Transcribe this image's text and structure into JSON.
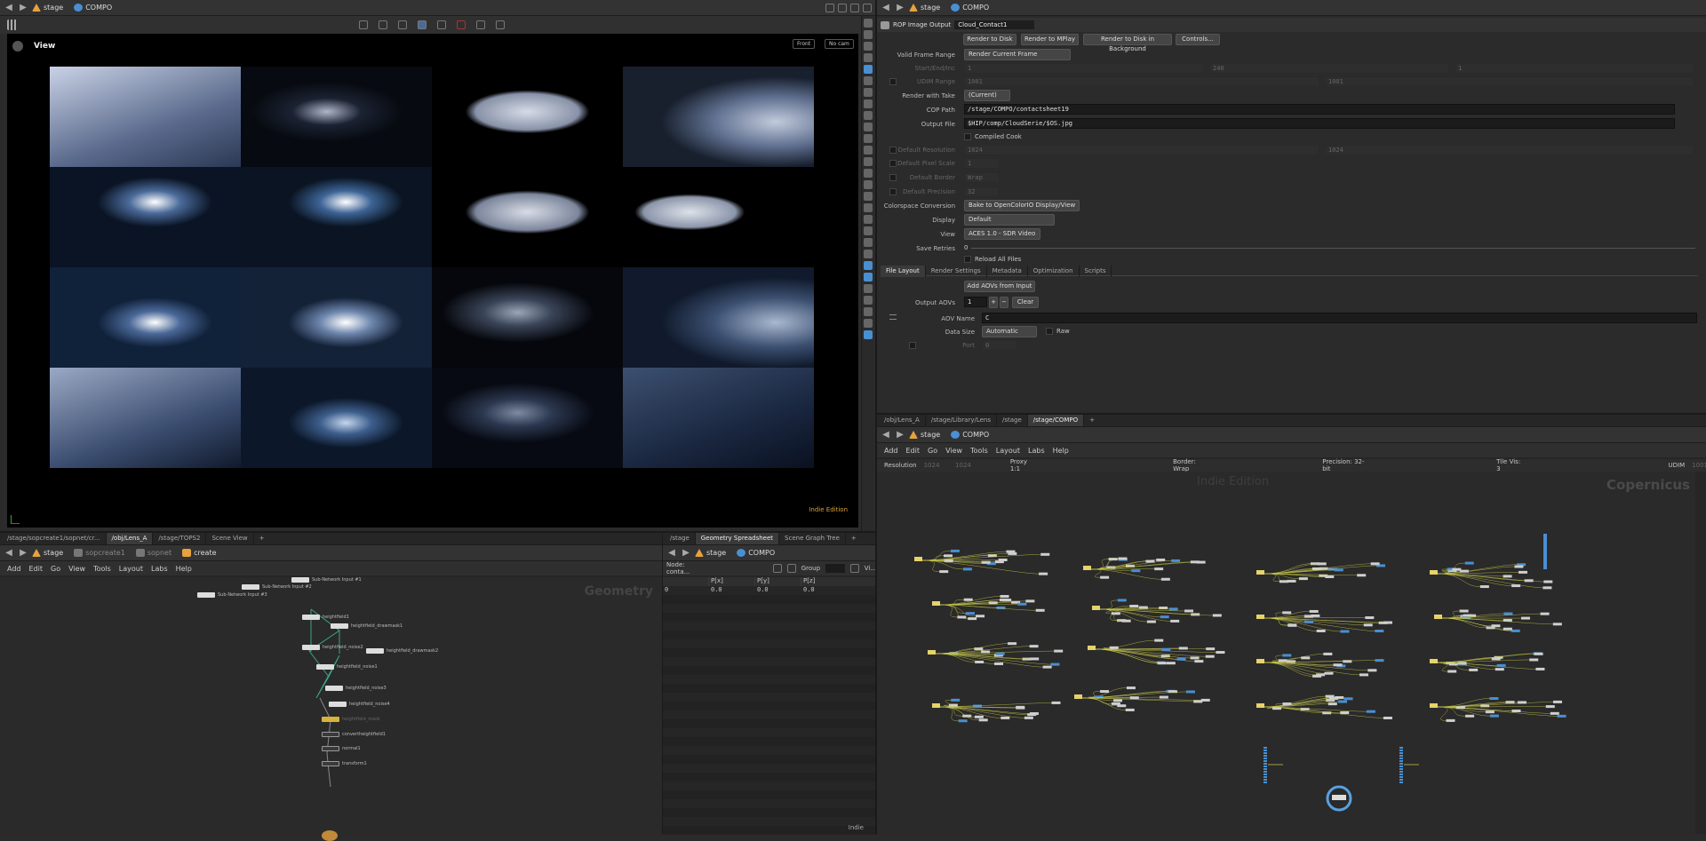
{
  "left_pathbar": {
    "items": [
      "stage",
      "COMPO"
    ]
  },
  "viewer": {
    "title": "View",
    "cam_front": "Front",
    "cam_no": "No cam",
    "edition": "Indie Edition"
  },
  "clouds": [
    {
      "a": "#c9d2e6",
      "b": "#5a6a8c",
      "c": "#2c3854",
      "kind": "haze"
    },
    {
      "a": "#aeb6c8",
      "b": "#1b2232",
      "c": "#070a10",
      "kind": "dark"
    },
    {
      "a": "#d6dbe6",
      "b": "#8892a8",
      "c": "#000",
      "kind": "puff"
    },
    {
      "a": "#c2cbdc",
      "b": "#5f6f8f",
      "c": "#18202e",
      "kind": "puffedge"
    },
    {
      "a": "#ffffff",
      "b": "#4a6a9a",
      "c": "#0a1424",
      "kind": "glow"
    },
    {
      "a": "#ffffff",
      "b": "#3d6496",
      "c": "#0a1422",
      "kind": "glow2"
    },
    {
      "a": "#d8dce6",
      "b": "#7c869c",
      "c": "#000",
      "kind": "puff"
    },
    {
      "a": "#dde2ea",
      "b": "#8c96aa",
      "c": "#000",
      "kind": "puffhalf"
    },
    {
      "a": "#ffffff",
      "b": "#4a6898",
      "c": "#10213a",
      "kind": "glow"
    },
    {
      "a": "#ffffff",
      "b": "#6d86ad",
      "c": "#142238",
      "kind": "glow"
    },
    {
      "a": "#9ca6b8",
      "b": "#3a4458",
      "c": "#05070c",
      "kind": "dark"
    },
    {
      "a": "#a8b8d0",
      "b": "#3b4f70",
      "c": "#101a2c",
      "kind": "puffedge"
    },
    {
      "a": "#9aa9c4",
      "b": "#3b4d70",
      "c": "#101a2c",
      "kind": "haze"
    },
    {
      "a": "#c5d6ec",
      "b": "#3d5e8c",
      "c": "#0c182a",
      "kind": "glow"
    },
    {
      "a": "#7c8aa2",
      "b": "#2c3850",
      "c": "#070a12",
      "kind": "dark"
    },
    {
      "a": "#3c5070",
      "b": "#1a2740",
      "c": "#0a1120",
      "kind": "haze"
    }
  ],
  "bottom_left": {
    "tabs": [
      "/stage/sopcreate1/sopnet/cr...",
      "/obj/Lens_A",
      "/stage/TOPS2",
      "Scene View"
    ],
    "crumbs": [
      "stage",
      "sopcreate1",
      "sopnet",
      "create"
    ],
    "menu": [
      "Add",
      "Edit",
      "Go",
      "View",
      "Tools",
      "Layout",
      "Labs",
      "Help"
    ],
    "watermark": "Geometry",
    "nodes": [
      {
        "label": "Sub-Network Input #1"
      },
      {
        "label": "Sub-Network Input #2"
      },
      {
        "label": "Sub-Network Input #3"
      },
      {
        "label": "heightfield1"
      },
      {
        "label": "heightfield_drawmask1"
      },
      {
        "label": "heightfield_noise2"
      },
      {
        "label": "heightfield_drawmask2"
      },
      {
        "label": "heightfield_noise1"
      },
      {
        "label": "heightfield_noise3"
      },
      {
        "label": "heightfield_noise4"
      },
      {
        "label": "heightfield_mask"
      },
      {
        "label": "convertheightfield1"
      },
      {
        "label": "normal1"
      },
      {
        "label": "transform1"
      }
    ]
  },
  "spreadsheet": {
    "tabs": [
      "/stage",
      "Geometry Spreadsheet",
      "Scene Graph Tree"
    ],
    "crumbs": [
      "stage",
      "COMPO"
    ],
    "node_label": "Node: conta...",
    "group_label": "Group",
    "view_label": "Vi...",
    "columns": [
      "",
      "P[x]",
      "P[y]",
      "P[z]"
    ],
    "row": [
      "0",
      "0.0",
      "0.0",
      "0.0"
    ],
    "footer": "Indie"
  },
  "rop": {
    "header_label": "ROP Image Output",
    "name": "Cloud_Contact1",
    "buttons": [
      "Render to Disk",
      "Render to MPlay",
      "Render to Disk in Background",
      "Controls..."
    ],
    "valid_frame_range_label": "Valid Frame Range",
    "valid_frame_range": "Render Current Frame",
    "start_end_inc_label": "Start/End/Inc",
    "start": "1",
    "end": "240",
    "inc": "1",
    "udim_range_label": "UDIM Range",
    "udim_start": "1001",
    "udim_end": "1001",
    "render_with_take_label": "Render with Take",
    "render_with_take": "(Current)",
    "cop_path_label": "COP Path",
    "cop_path": "/stage/COMPO/contactsheet19",
    "output_file_label": "Output File",
    "output_file": "$HIP/comp/CloudSerie/$OS.jpg",
    "compiled_cook": "Compiled Cook",
    "default_resolution_label": "Default Resolution",
    "def_res_w": "1024",
    "def_res_h": "1024",
    "default_pixel_scale_label": "Default Pixel Scale",
    "pixel_scale": "1",
    "default_border_label": "Default Border",
    "border": "Wrap",
    "default_precision_label": "Default Precision",
    "precision": "32",
    "colorspace_label": "Colorspace Conversion",
    "colorspace": "Bake to OpenColorIO Display/View",
    "display_label": "Display",
    "display": "Default",
    "view_label": "View",
    "view": "ACES 1.0 - SDR Video",
    "save_retries_label": "Save Retries",
    "save_retries": "0",
    "reload_all": "Reload All Files",
    "tabs": [
      "File Layout",
      "Render Settings",
      "Metadata",
      "Optimization",
      "Scripts"
    ],
    "add_aovs": "Add AOVs from Input",
    "output_aovs_label": "Output AOVs",
    "output_aovs": "1",
    "clear": "Clear",
    "aov_name_label": "AOV Name",
    "aov_name": "C",
    "data_size_label": "Data Size",
    "data_size": "Automatic",
    "raw": "Raw",
    "port_label": "Port",
    "port": "0"
  },
  "cop_net": {
    "tabs": [
      "/obj/Lens_A",
      "/stage/Library/Lens",
      "/stage",
      "/stage/COMPO"
    ],
    "crumbs": [
      "stage",
      "COMPO"
    ],
    "menu": [
      "Add",
      "Edit",
      "Go",
      "View",
      "Tools",
      "Layout",
      "Labs",
      "Help"
    ],
    "resolution_label": "Resolution",
    "res_w": "1024",
    "res_h": "1024",
    "proxy": "Proxy 1:1",
    "border": "Border: Wrap",
    "precision": "Precision: 32-bit",
    "tile_vis": "Tile Vis: 3",
    "udim_label": "UDIM",
    "udim": "1001",
    "watermark": "Indie Edition",
    "context": "Copernicus"
  },
  "colors": {
    "accent": "#e8a23c",
    "blue": "#4a8fd1",
    "wire": "#c8c84a",
    "selected": "#5aa0e0"
  }
}
